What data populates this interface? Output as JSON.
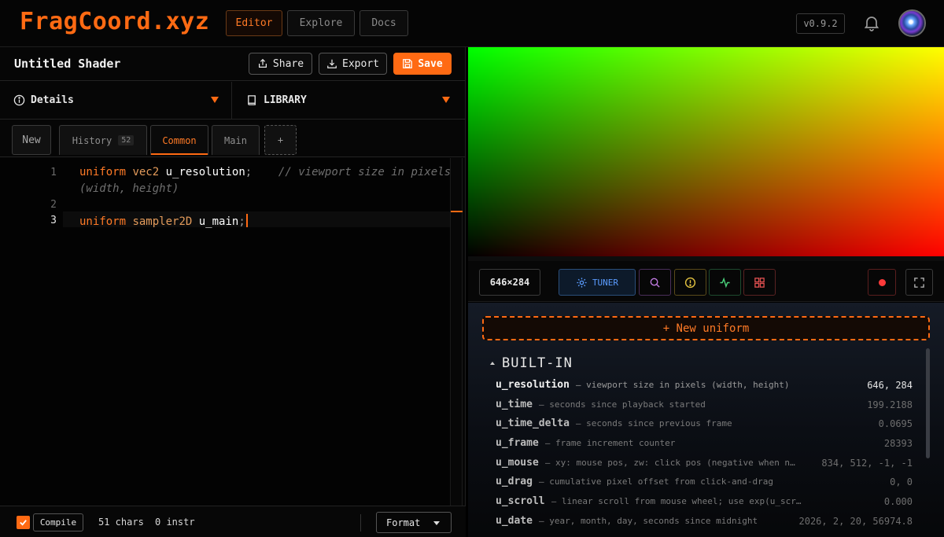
{
  "app": {
    "logo": "FragCoord.xyz",
    "nav": [
      {
        "label": "Editor",
        "active": true
      },
      {
        "label": "Explore",
        "active": false
      },
      {
        "label": "Docs",
        "active": false
      }
    ],
    "version": "v0.9.2"
  },
  "editor_header": {
    "title": "Untitled Shader",
    "share_label": "Share",
    "export_label": "Export",
    "save_label": "Save"
  },
  "panels": {
    "details_label": "Details",
    "library_label": "LIBRARY"
  },
  "tabs": {
    "new_label": "New",
    "history_label": "History",
    "history_count": "52",
    "common_label": "Common",
    "main_label": "Main",
    "add_label": "+"
  },
  "code": {
    "lines": [
      {
        "number": "1",
        "keyword": "uniform",
        "type": "vec2",
        "name": "u_resolution",
        "punct": ";",
        "comment": "// viewport size in pixels",
        "comment_wrap": "(width, height)"
      },
      {
        "number": "2"
      },
      {
        "number": "3",
        "keyword": "uniform",
        "type": "sampler2D",
        "name": "u_main",
        "punct": ";"
      }
    ]
  },
  "status": {
    "compile_label": "Compile",
    "chars": "51 chars",
    "instr": "0 instr",
    "format_label": "Format"
  },
  "preview": {
    "dims": "646×284",
    "tuner_label": "TUNER"
  },
  "tuner": {
    "new_uniform_label": "+ New uniform",
    "builtin_label": "BUILT-IN",
    "uniforms": [
      {
        "name": "u_resolution",
        "desc": "— viewport size in pixels (width, height)",
        "value": "646, 284"
      },
      {
        "name": "u_time",
        "desc": "— seconds since playback started",
        "value": "199.2188"
      },
      {
        "name": "u_time_delta",
        "desc": "— seconds since previous frame",
        "value": "0.0695"
      },
      {
        "name": "u_frame",
        "desc": "— frame increment counter",
        "value": "28393"
      },
      {
        "name": "u_mouse",
        "desc": "— xy: mouse pos, zw: click pos (negative when not pre…",
        "value": "834, 512, -1, -1"
      },
      {
        "name": "u_drag",
        "desc": "— cumulative pixel offset from click-and-drag",
        "value": "0, 0"
      },
      {
        "name": "u_scroll",
        "desc": "— linear scroll from mouse wheel; use exp(u_scroll) for zoom",
        "value": "0.000"
      },
      {
        "name": "u_date",
        "desc": "— year, month, day, seconds since midnight",
        "value": "2026, 2, 20, 56974.8"
      }
    ]
  },
  "colors": {
    "accent": "#ff6a13",
    "tuner_blue": "#5b9cff"
  },
  "icons": {
    "share": "share-icon",
    "export": "download-icon",
    "save": "save-icon",
    "details": "info-icon",
    "library": "book-icon",
    "bell": "bell-icon",
    "tuner": "gear-icon",
    "search": "search-icon",
    "warn": "alert-icon",
    "perf": "activity-icon",
    "grid": "grid-icon",
    "record": "record-icon",
    "fullscreen": "fullscreen-icon"
  }
}
